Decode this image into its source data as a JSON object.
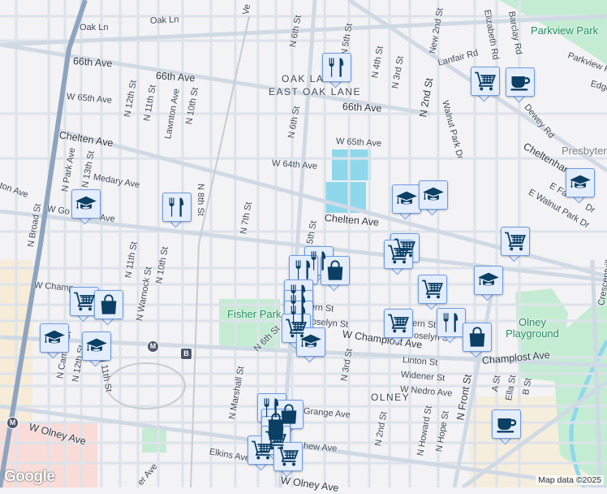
{
  "map": {
    "labels": {
      "oak_ln": "Oak Ln",
      "ave66": "66th Ave",
      "w65": "W 65th Ave",
      "chelten": "Chelten Ave",
      "w64": "W 64th Ave",
      "medary": "Medary Ave",
      "n_park": "N Park Ave",
      "n13": "N 13th St",
      "n12": "N 12th St",
      "n11": "N 11th St",
      "lawnton": "Lawnton Ave",
      "n10": "N 10th St",
      "n8": "N 8th St",
      "n7": "N 7th St",
      "n6": "N 6th St",
      "n5": "N 5th St",
      "n4": "N 4th St",
      "n3": "N 3rd St",
      "new2": "New 2nd St",
      "n2": "N 2nd St",
      "lanfair": "Lanfair Rd",
      "elizabeth": "Elizabeth Rd",
      "barclay": "Barclay Rd",
      "parkview_rd": "Parkview Rd",
      "edge": "Edge",
      "dewey": "Dewey Rd",
      "walnut_park": "Walnut Park Dr",
      "cheltenham": "Cheltenham Ave",
      "e_fa": "E Fa",
      "e_fa_dr": "Dr",
      "e_walnut": "E Walnut Park Dr",
      "w_go": "W Go",
      "go_ave": "Ave",
      "ton_ave": "ton Ave",
      "n_broad": "N Broad St",
      "n_warnock": "N Warnock St",
      "w_champ": "W Champ",
      "n_camac": "N Camac St",
      "w_olney": "W Olney Ave",
      "n_marshall": "N Marshall St",
      "elkins": "Elkins Ave",
      "er_ave": "er Ave",
      "ern": "ern St",
      "oselyn": "oselyn St",
      "w_champlost": "W Champlost Ave",
      "e_champlost": "Champlost Ave",
      "linton": "Linton St",
      "widener": "Widener St",
      "nedro": "W Nedro Ave",
      "grange": "Grange Ave",
      "hew": "hew Ave",
      "n_howard": "N Howard St",
      "n_hope": "N Hope St",
      "n_front": "N Front St",
      "a_st": "A St",
      "ella": "Ella St",
      "b_st": "B St",
      "crescentville": "Crescentville",
      "ve": "Ve"
    },
    "neighborhoods": {
      "oak_lane": "OAK LANE",
      "east_oak_lane": "EAST OAK LANE",
      "olney": "OLNEY"
    },
    "parks": {
      "parkview": "Parkview Park",
      "fisher": "Fisher Park",
      "olney_pg": "Olney Playground"
    },
    "poi": {
      "presbyterian": "Presbyter"
    },
    "transit": {
      "metro": "M",
      "bus": "B"
    },
    "markers": [
      "restaurant",
      "grocery",
      "coffee",
      "school",
      "school",
      "school",
      "school",
      "restaurant",
      "grocery",
      "restaurant",
      "shopping",
      "restaurant",
      "grocery",
      "school",
      "grocery",
      "restaurant",
      "restaurant",
      "restaurant",
      "grocery",
      "school",
      "grocery",
      "restaurant",
      "shopping",
      "grocery",
      "shopping",
      "school",
      "school",
      "grocery",
      "restaurant",
      "shopping",
      "shopping",
      "shopping",
      "grocery",
      "grocery",
      "grocery",
      "coffee"
    ],
    "attribution": "Map data ©2025",
    "logo": "Google",
    "colors": {
      "marker_bg": "#e4edfc",
      "marker_border": "#6d9be0",
      "icon": "#0b3f63",
      "park": "#c4ecd3",
      "water": "#8fd8ec"
    }
  }
}
